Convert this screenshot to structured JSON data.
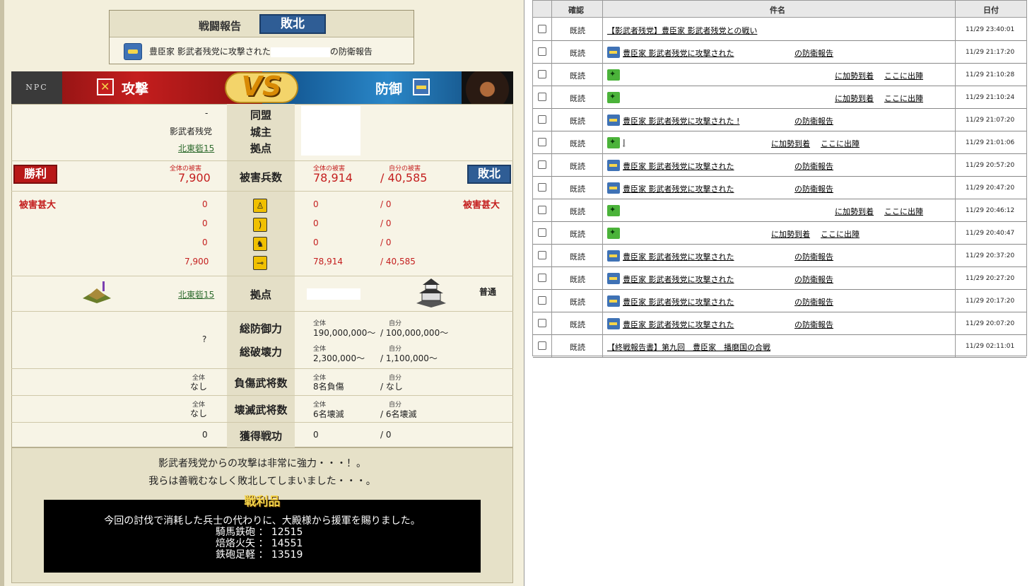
{
  "report": {
    "title": "戦闘報告",
    "result": "敗北",
    "subject_prefix": "豊臣家 影武者残党に攻撃された",
    "subject_suffix": "の防衛報告"
  },
  "vs": {
    "npc_label": "NPC",
    "attack_label": "攻撃",
    "defense_label": "防御",
    "vs_text": "VS"
  },
  "info": {
    "alliance_label": "同盟",
    "lord_label": "城主",
    "base_label": "拠点",
    "atk_alliance": "-",
    "atk_lord": "影武者残党",
    "atk_base": "北東砦15"
  },
  "losses": {
    "label": "被害兵数",
    "total_caption": "全体の被害",
    "self_caption": "自分の被害",
    "atk_result": "勝利",
    "def_result": "敗北",
    "atk_total": "7,900",
    "def_total": "78,914",
    "def_self": "/ 40,585",
    "atk_status": "被害甚大",
    "def_status": "被害甚大",
    "units": [
      {
        "icon": "infantry-icon",
        "atk": "0",
        "def_total": "0",
        "def_self": "/ 0"
      },
      {
        "icon": "bow-icon",
        "atk": "0",
        "def_total": "0",
        "def_self": "/ 0"
      },
      {
        "icon": "cavalry-icon",
        "atk": "0",
        "def_total": "0",
        "def_self": "/ 0"
      },
      {
        "icon": "gun-icon",
        "atk": "7,900",
        "def_total": "78,914",
        "def_self": "/ 40,585"
      }
    ]
  },
  "base": {
    "label": "拠点",
    "atk_base": "北東砦15",
    "def_status": "普通"
  },
  "power": {
    "def_label": "総防御力",
    "break_label": "総破壊力",
    "atk_value": "?",
    "all_caption": "全体",
    "self_caption": "自分",
    "def_total": "190,000,000～",
    "def_self": "/ 100,000,000～",
    "break_total": "2,300,000～",
    "break_self": "/ 1,100,000～"
  },
  "injured": {
    "label": "負傷武将数",
    "atk_caption": "全体",
    "atk_value": "なし",
    "all_caption": "全体",
    "self_caption": "自分",
    "def_total": "8名負傷",
    "def_self": "/ なし"
  },
  "destroyed": {
    "label": "壊滅武将数",
    "atk_caption": "全体",
    "atk_value": "なし",
    "all_caption": "全体",
    "self_caption": "自分",
    "def_total": "6名壊滅",
    "def_self": "/ 6名壊滅"
  },
  "merit": {
    "label": "獲得戦功",
    "atk_value": "0",
    "def_total": "0",
    "def_self": "/ 0"
  },
  "message": {
    "line1": "影武者残党からの攻撃は非常に強力・・・！。",
    "line2": "我らは善戦むなしく敗北してしまいました・・・。"
  },
  "loot": {
    "title": "戦利品",
    "intro": "今回の討伐で消耗した兵士の代わりに、大殿様から援軍を賜りました。",
    "items": [
      "騎馬鉄砲 ： 12515",
      "焙烙火矢 ： 14551",
      "鉄砲足軽 ： 13519"
    ]
  },
  "inbox": {
    "headers": {
      "check": "確認",
      "subject": "件名",
      "date": "日付"
    },
    "rows": [
      {
        "status": "既読",
        "type": "none",
        "subject": "【影武者残党】豊臣家 影武者残党との戦い",
        "extra": "",
        "extra2": "",
        "date": "11/29 23:40:01"
      },
      {
        "status": "既読",
        "type": "def",
        "subject": "豊臣家 影武者残党に攻撃された",
        "extra": "の防衛報告",
        "extra2": "",
        "date": "11/29 21:17:20"
      },
      {
        "status": "既読",
        "type": "grn",
        "subject": "",
        "extra": "に加勢到着",
        "extra2": "ここに出陣",
        "date": "11/29 21:10:28"
      },
      {
        "status": "既読",
        "type": "grn",
        "subject": "",
        "extra": "に加勢到着",
        "extra2": "ここに出陣",
        "date": "11/29 21:10:24"
      },
      {
        "status": "既読",
        "type": "def",
        "subject": "豊臣家 影武者残党に攻撃された !",
        "extra": "の防衛報告",
        "extra2": "",
        "date": "11/29 21:07:20"
      },
      {
        "status": "既読",
        "type": "grn",
        "subject": "|",
        "extra": "に加勢到着",
        "extra2": "ここに出陣",
        "date": "11/29 21:01:06"
      },
      {
        "status": "既読",
        "type": "def",
        "subject": "豊臣家 影武者残党に攻撃された",
        "extra": "の防衛報告",
        "extra2": "",
        "date": "11/29 20:57:20"
      },
      {
        "status": "既読",
        "type": "def",
        "subject": "豊臣家 影武者残党に攻撃された",
        "extra": "の防衛報告",
        "extra2": "",
        "date": "11/29 20:47:20"
      },
      {
        "status": "既読",
        "type": "grn",
        "subject": "",
        "extra": "に加勢到着",
        "extra2": "ここに出陣",
        "date": "11/29 20:46:12"
      },
      {
        "status": "既読",
        "type": "grn",
        "subject": "",
        "extra": "に加勢到着",
        "extra2": "ここに出陣",
        "date": "11/29 20:40:47"
      },
      {
        "status": "既読",
        "type": "def",
        "subject": "豊臣家 影武者残党に攻撃された",
        "extra": "の防衛報告",
        "extra2": "",
        "date": "11/29 20:37:20"
      },
      {
        "status": "既読",
        "type": "def",
        "subject": "豊臣家 影武者残党に攻撃された",
        "extra": "の防衛報告",
        "extra2": "",
        "date": "11/29 20:27:20"
      },
      {
        "status": "既読",
        "type": "def",
        "subject": "豊臣家 影武者残党に攻撃された",
        "extra": "の防衛報告",
        "extra2": "",
        "date": "11/29 20:17:20"
      },
      {
        "status": "既読",
        "type": "def",
        "subject": "豊臣家 影武者残党に攻撃された",
        "extra": "の防衛報告",
        "extra2": "",
        "date": "11/29 20:07:20"
      },
      {
        "status": "既読",
        "type": "none",
        "subject": "【終戦報告書】第九回　豊臣家　播磨国の合戦",
        "extra": "",
        "extra2": "",
        "date": "11/29 02:11:01"
      }
    ]
  }
}
